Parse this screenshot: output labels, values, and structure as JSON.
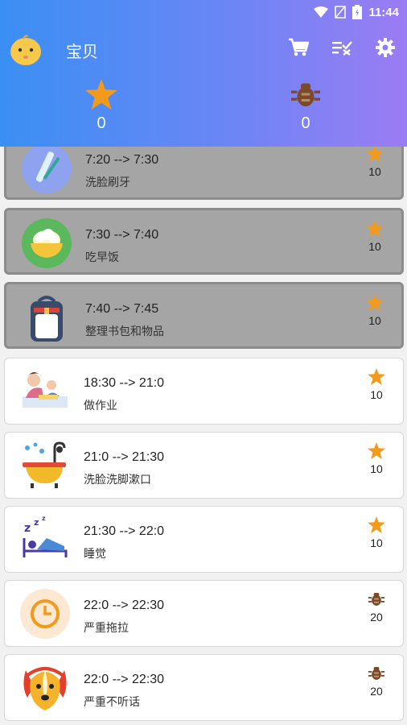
{
  "statusbar": {
    "time": "11:44"
  },
  "header": {
    "title": "宝贝",
    "star_count": "0",
    "bug_count": "0"
  },
  "colors": {
    "star": "#f39a1c",
    "bug": "#7a4a2a",
    "header_start": "#3a8ff4",
    "header_end": "#9b7cf4"
  },
  "tasks": [
    {
      "time": "7:20  -->  7:30",
      "name": "洗脸刷牙",
      "points": "10",
      "reward": "star-icon",
      "icon": "toothbrush-icon",
      "done": true
    },
    {
      "time": "7:30  -->  7:40",
      "name": "吃早饭",
      "points": "10",
      "reward": "star-icon",
      "icon": "rice-bowl-icon",
      "done": true
    },
    {
      "time": "7:40  -->  7:45",
      "name": "整理书包和物品",
      "points": "10",
      "reward": "star-icon",
      "icon": "backpack-icon",
      "done": true
    },
    {
      "time": "18:30  -->  21:0",
      "name": "做作业",
      "points": "10",
      "reward": "star-icon",
      "icon": "homework-icon",
      "done": false
    },
    {
      "time": "21:0  -->  21:30",
      "name": "洗脸洗脚漱口",
      "points": "10",
      "reward": "star-icon",
      "icon": "bathtub-icon",
      "done": false
    },
    {
      "time": "21:30  -->  22:0",
      "name": "睡觉",
      "points": "10",
      "reward": "star-icon",
      "icon": "sleep-icon",
      "done": false
    },
    {
      "time": "22:0  -->  22:30",
      "name": "严重拖拉",
      "points": "20",
      "reward": "bug-icon",
      "icon": "clock-icon",
      "done": false
    },
    {
      "time": "22:0  -->  22:30",
      "name": "严重不听话",
      "points": "20",
      "reward": "bug-icon",
      "icon": "dog-icon",
      "done": false
    }
  ]
}
